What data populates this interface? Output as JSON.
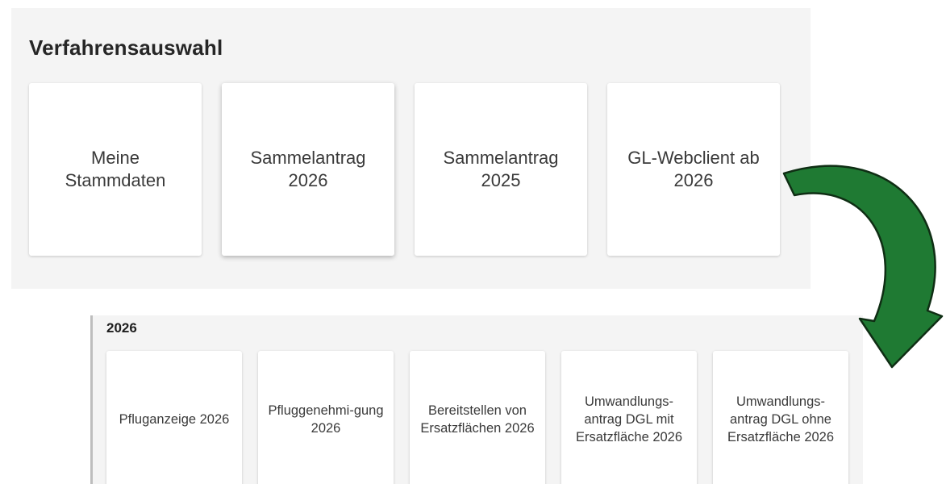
{
  "top_panel": {
    "title": "Verfahrensauswahl",
    "cards": [
      {
        "label": "Meine Stammdaten"
      },
      {
        "label": "Sammelantrag 2026"
      },
      {
        "label": "Sammelantrag 2025"
      },
      {
        "label": "GL-Webclient ab 2026"
      }
    ]
  },
  "bottom_panel": {
    "title": "2026",
    "cards": [
      {
        "label": "Pfluganzeige 2026"
      },
      {
        "label": "Pfluggenehmi-gung 2026"
      },
      {
        "label": "Bereitstellen von Ersatzflächen 2026"
      },
      {
        "label": "Umwandlungs-antrag DGL mit Ersatzfläche 2026"
      },
      {
        "label": "Umwandlungs-antrag DGL ohne Ersatzfläche 2026"
      }
    ]
  },
  "colors": {
    "panel_background": "#f4f4f4",
    "card_background": "#ffffff",
    "arrow_fill": "#1f7a33",
    "arrow_stroke": "#0f2e14"
  }
}
